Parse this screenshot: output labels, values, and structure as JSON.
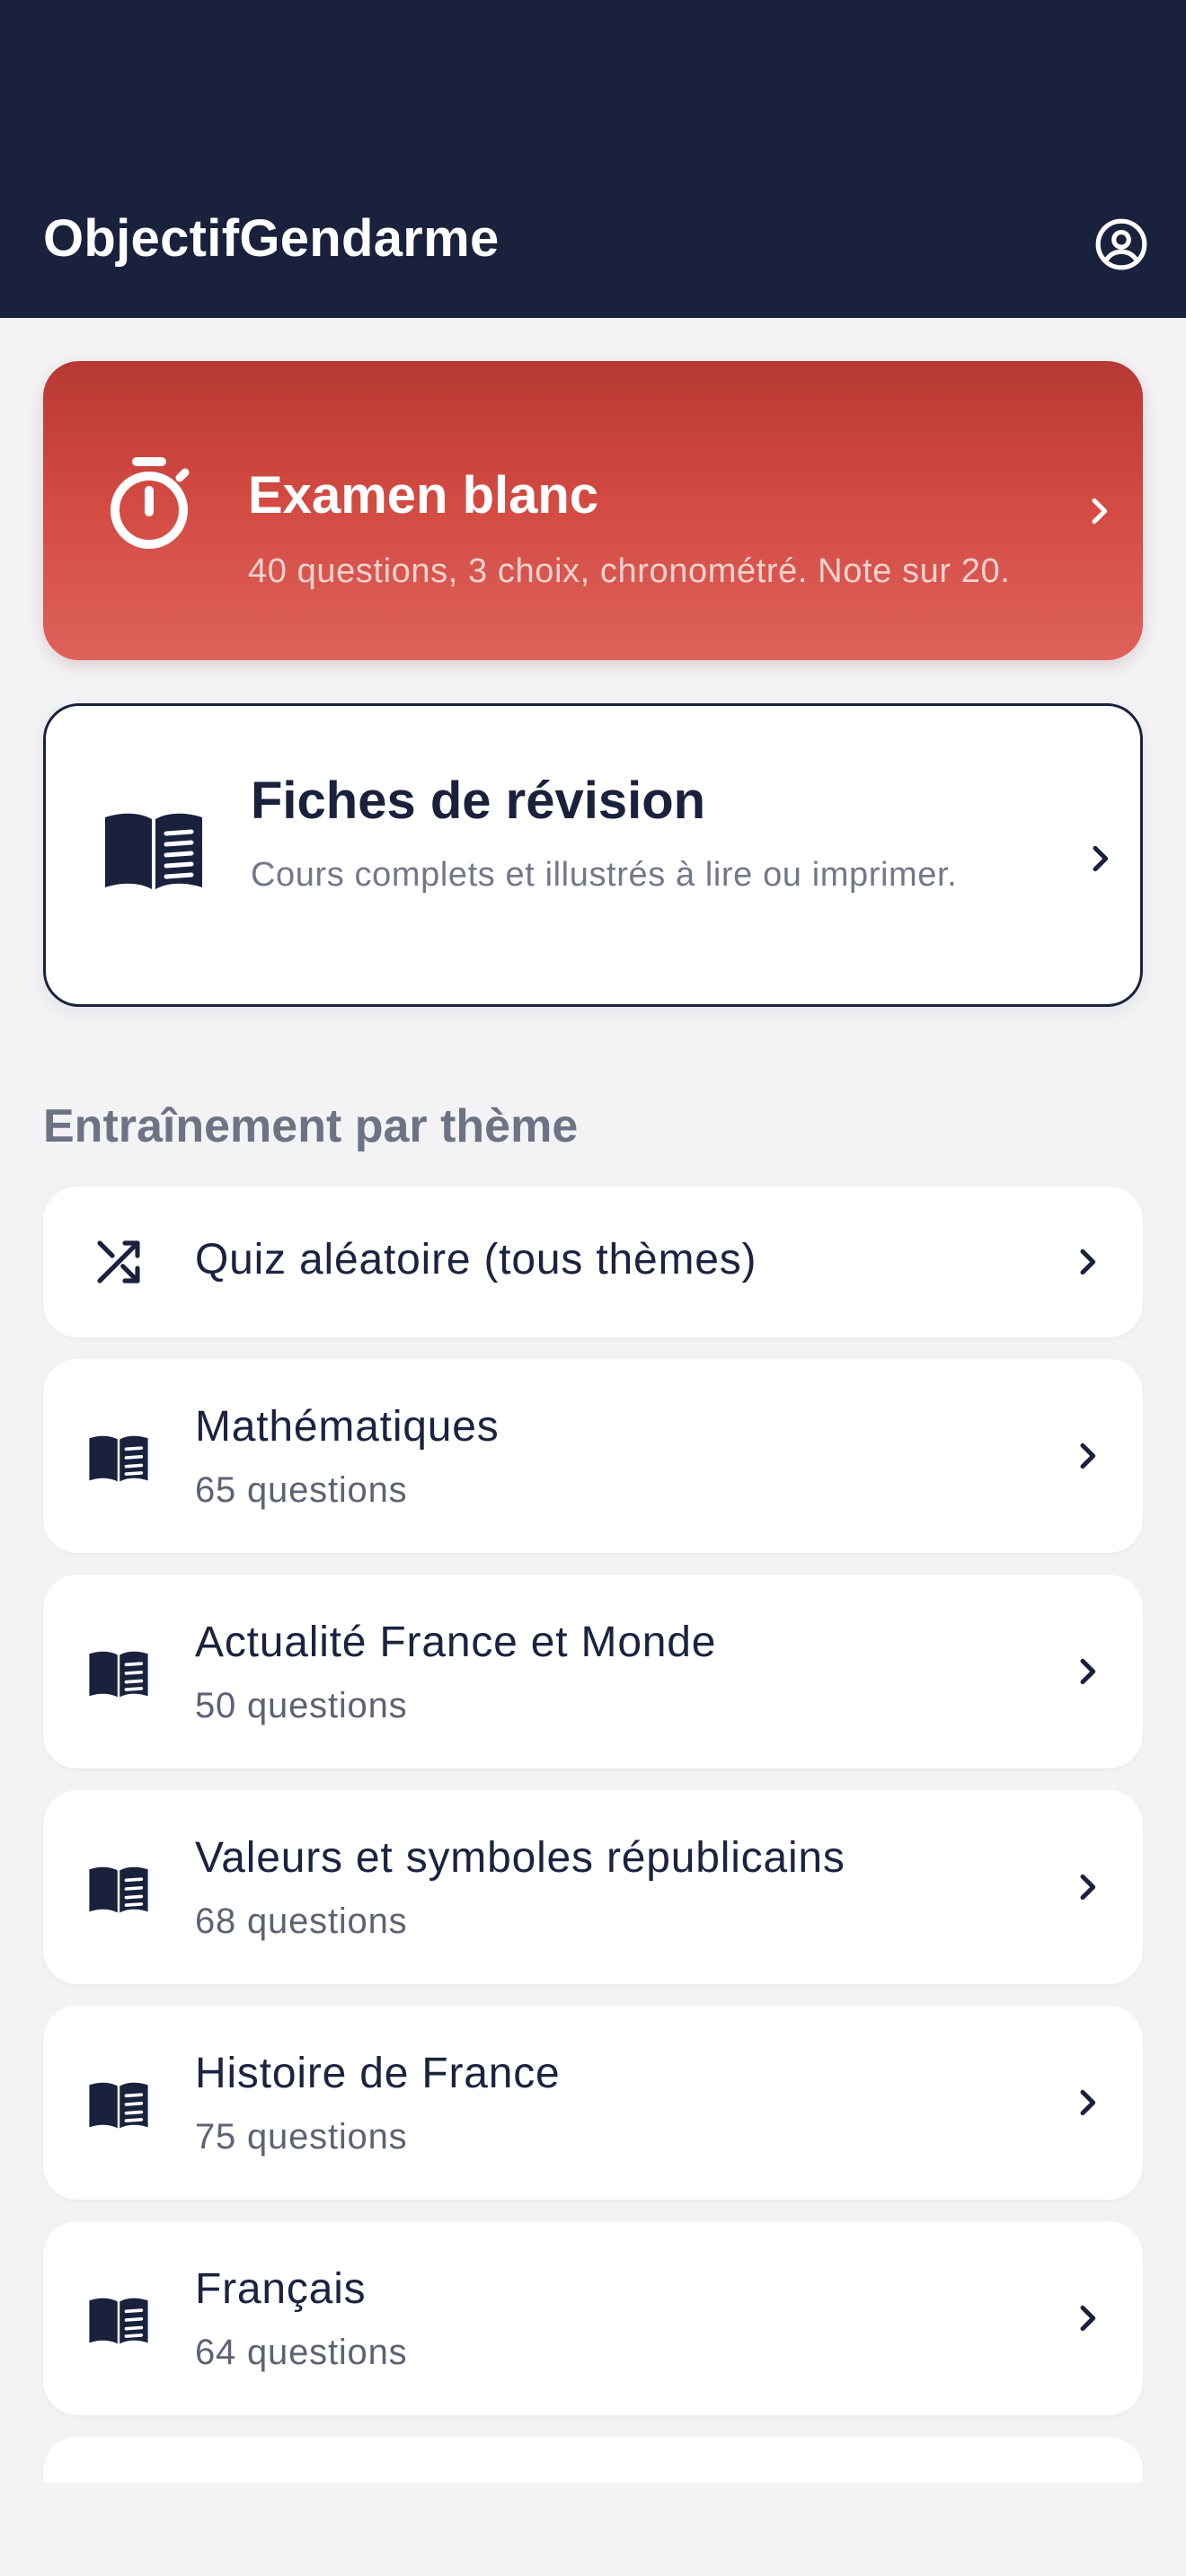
{
  "header": {
    "title": "ObjectifGendarme",
    "profile_icon": "account-circle-icon"
  },
  "cards": {
    "exam": {
      "title": "Examen blanc",
      "description": "40 questions, 3 choix, chronométré. Note sur 20.",
      "icon": "stopwatch-icon",
      "color": "#d0453f"
    },
    "revision": {
      "title": "Fiches de révision",
      "description": "Cours complets et illustrés à lire ou imprimer.",
      "icon": "open-book-icon"
    }
  },
  "section": {
    "title": "Entraînement par thème"
  },
  "themes": [
    {
      "title": "Quiz aléatoire (tous thèmes)",
      "icon": "shuffle-icon"
    },
    {
      "title": "Mathématiques",
      "subtitle": "65 questions",
      "icon": "book-icon"
    },
    {
      "title": "Actualité France et Monde",
      "subtitle": "50 questions",
      "icon": "book-icon"
    },
    {
      "title": "Valeurs et symboles républicains",
      "subtitle": "68 questions",
      "icon": "book-icon"
    },
    {
      "title": "Histoire de France",
      "subtitle": "75 questions",
      "icon": "book-icon"
    },
    {
      "title": "Français",
      "subtitle": "64 questions",
      "icon": "book-icon"
    }
  ],
  "colors": {
    "navy": "#19213d",
    "background": "#f3f3f6",
    "muted": "#6d7385"
  }
}
